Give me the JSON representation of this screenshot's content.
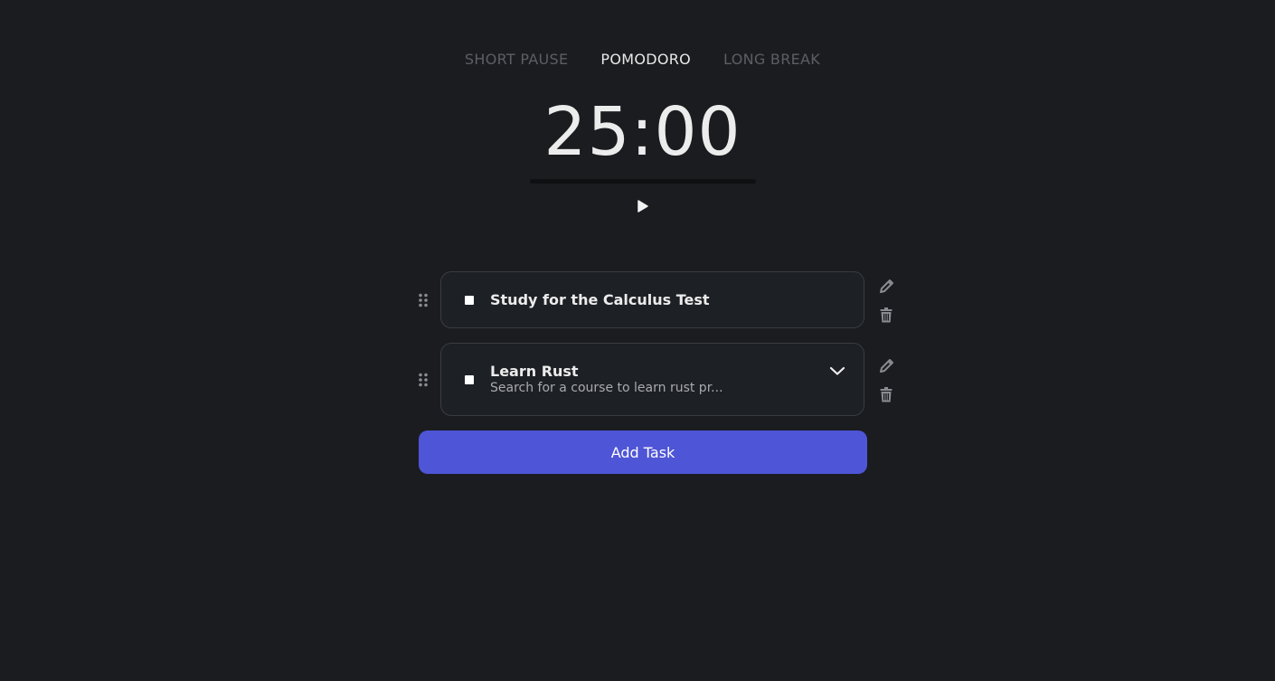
{
  "modes": {
    "short_pause": "SHORT PAUSE",
    "pomodoro": "POMODORO",
    "long_break": "LONG BREAK",
    "active": "pomodoro"
  },
  "timer": {
    "display": "25:00",
    "progress": 0
  },
  "tasks": [
    {
      "title": "Study for the Calculus Test",
      "description": "",
      "completed": false,
      "expandable": false
    },
    {
      "title": "Learn Rust",
      "description": "Search for a course to learn rust pr...",
      "completed": false,
      "expandable": true
    }
  ],
  "add_task_label": "Add Task",
  "colors": {
    "background": "#1b1c20",
    "accent": "#4e55d6",
    "card": "#1d2024",
    "card_border": "#3a3c42",
    "muted_text": "#5d5e63"
  },
  "icons": {
    "play": "play-icon",
    "drag": "drag-handle-icon",
    "edit": "pencil-icon",
    "delete": "trash-icon",
    "expand": "chevron-down-icon"
  }
}
